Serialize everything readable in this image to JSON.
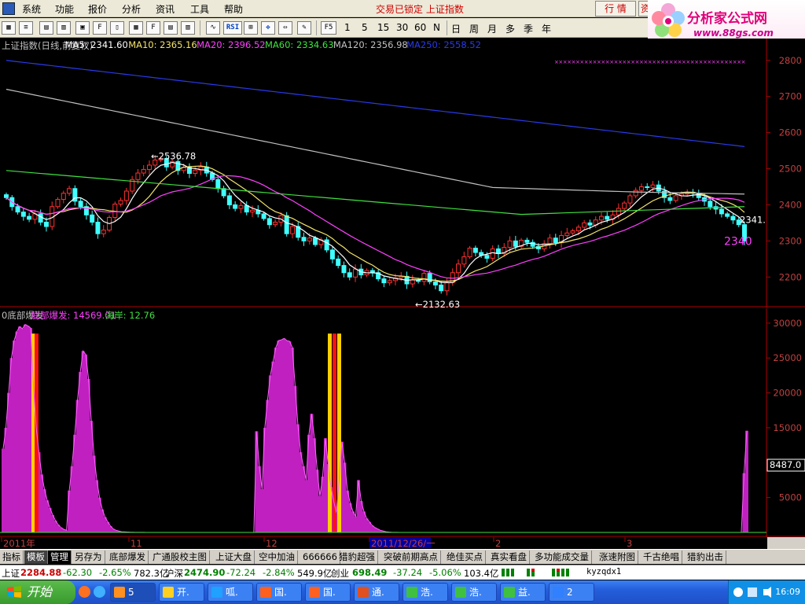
{
  "menu": {
    "items": [
      "系统",
      "功能",
      "报价",
      "分析",
      "资讯",
      "工具",
      "帮助"
    ],
    "title": "交易已锁定 上证指数",
    "quote_button": "行 情",
    "info_button": "资"
  },
  "toolbar": {
    "icons": [
      "F5",
      "RSI"
    ],
    "periods": [
      "1",
      "5",
      "15",
      "30",
      "60",
      "N",
      "日",
      "周",
      "月",
      "多",
      "季",
      "年"
    ]
  },
  "logo": {
    "name": "分析家公式网",
    "url": "www.88gs.com"
  },
  "price_chart": {
    "header": [
      {
        "text": "上证指数(日线,前复权)",
        "color": "#c0c0c0"
      },
      {
        "text": "MA5: 2341.60",
        "color": "#ffffff"
      },
      {
        "text": "MA10: 2365.16",
        "color": "#f4e46a"
      },
      {
        "text": "MA20: 2396.52",
        "color": "#ff40ff"
      },
      {
        "text": "MA60: 2334.63",
        "color": "#40e040"
      },
      {
        "text": "MA120: 2356.98",
        "color": "#c0c0c0"
      },
      {
        "text": "MA250: 2558.52",
        "color": "#2a3ae8"
      }
    ],
    "annotations": {
      "high": "2536.78",
      "low": "←2132.63",
      "last": "2341.",
      "current": "2340"
    }
  },
  "indicator": {
    "header": [
      {
        "text": "0底部爆发",
        "color": "#c0c0c0"
      },
      {
        "text": "底部爆发: 14569.01",
        "color": "#ff40ff"
      },
      {
        "text": "海岸: 12.76",
        "color": "#40e040"
      }
    ],
    "current_value": "8487.0"
  },
  "date_axis": {
    "labels": [
      "2011年",
      "11",
      "12",
      "2011/12/26/一",
      "2",
      "3"
    ],
    "period": "日线"
  },
  "tabs": [
    "指标",
    "模板",
    "管理",
    "另存为",
    "底部爆发",
    "广通股校主图",
    "上证大盘",
    "空中加油",
    "666666",
    "猎豹超强",
    "突破前期高点",
    "绝佳买点",
    "真实看盘",
    "多功能成交量",
    "涨速附图",
    "千古绝唱",
    "猎豹出击"
  ],
  "index_strip": [
    {
      "name": "上证",
      "value": "2284.88",
      "change": "-62.30",
      "pct": "-2.65%",
      "amount": "782.3亿"
    },
    {
      "name": "沪深",
      "value": "2474.90",
      "change": "-72.24",
      "pct": "-2.84%",
      "amount": "549.9亿"
    },
    {
      "name": "创业",
      "value": "698.49",
      "change": "-37.24",
      "pct": "-5.06%",
      "amount": "103.4亿"
    }
  ],
  "input_method": "kyzqdx1",
  "taskbar": {
    "start": "开始",
    "tasks": [
      "5",
      "开.",
      "呱.",
      "国.",
      "国.",
      "通.",
      "浩.",
      "浩.",
      "益.",
      "2"
    ],
    "clock": "16:09"
  },
  "chart_data": [
    {
      "type": "candlestick",
      "title": "上证指数(日线,前复权)",
      "ylim": [
        2120,
        2830
      ],
      "y_ticks": [
        2800,
        2700,
        2600,
        2500,
        2400,
        2300,
        2200
      ],
      "x_labels": [
        "2011年",
        "11",
        "12",
        "2011/12/26/一",
        "2",
        "3"
      ],
      "extremes": {
        "high": 2536.78,
        "low": 2132.63
      },
      "close": [
        2420,
        2395,
        2380,
        2368,
        2360,
        2375,
        2352,
        2340,
        2395,
        2415,
        2432,
        2445,
        2410,
        2395,
        2372,
        2352,
        2320,
        2330,
        2365,
        2402,
        2412,
        2438,
        2470,
        2488,
        2498,
        2510,
        2524,
        2528,
        2505,
        2520,
        2495,
        2504,
        2487,
        2496,
        2505,
        2488,
        2470,
        2445,
        2425,
        2400,
        2390,
        2398,
        2380,
        2385,
        2375,
        2362,
        2345,
        2352,
        2370,
        2320,
        2340,
        2310,
        2300,
        2308,
        2290,
        2303,
        2275,
        2250,
        2232,
        2212,
        2200,
        2222,
        2206,
        2218,
        2212,
        2195,
        2184,
        2190,
        2198,
        2202,
        2181,
        2192,
        2188,
        2210,
        2187,
        2178,
        2162,
        2185,
        2212,
        2236,
        2256,
        2280,
        2268,
        2260,
        2252,
        2278,
        2265,
        2282,
        2300,
        2285,
        2302,
        2296,
        2285,
        2278,
        2292,
        2308,
        2295,
        2315,
        2322,
        2328,
        2338,
        2350,
        2344,
        2358,
        2368,
        2360,
        2372,
        2390,
        2405,
        2425,
        2440,
        2450,
        2448,
        2455,
        2438,
        2420,
        2412,
        2425,
        2430,
        2435,
        2432,
        2420,
        2410,
        2395,
        2388,
        2375,
        2368,
        2358,
        2345,
        2300
      ],
      "series": [
        {
          "name": "MA5",
          "values": [
            2341.6
          ]
        },
        {
          "name": "MA10",
          "values": [
            2365.16
          ]
        },
        {
          "name": "MA20",
          "values": [
            2396.52
          ]
        },
        {
          "name": "MA60",
          "values": [
            2334.63
          ]
        },
        {
          "name": "MA120",
          "values": [
            2356.98
          ]
        },
        {
          "name": "MA250",
          "values": [
            2558.52
          ]
        }
      ]
    },
    {
      "type": "bar",
      "title": "0底部爆发",
      "ylim": [
        0,
        31000
      ],
      "y_ticks": [
        30000,
        25000,
        20000,
        15000,
        10000,
        5000
      ],
      "series": [
        {
          "name": "底部爆发",
          "values": [
            14569.01
          ]
        },
        {
          "name": "海岸",
          "values": [
            12.76
          ]
        }
      ],
      "values": [
        12000,
        15000,
        20000,
        25000,
        27500,
        28800,
        29500,
        29200,
        29800,
        29600,
        29300,
        21000,
        15000,
        11500,
        8300,
        6200,
        4600,
        3500,
        2500,
        1700,
        1100,
        700,
        450,
        300,
        6000,
        9500,
        14000,
        19000,
        23000,
        26000,
        25500,
        22000,
        16000,
        11000,
        7500,
        5000,
        3300,
        2200,
        1500,
        900,
        500,
        300,
        200,
        100,
        80,
        60,
        40,
        30,
        20,
        15,
        10,
        10,
        5,
        5,
        5,
        5,
        5,
        5,
        5,
        5,
        0,
        0,
        0,
        0,
        0,
        0,
        0,
        0,
        0,
        0,
        0,
        0,
        0,
        0,
        0,
        0,
        0,
        0,
        0,
        0,
        0,
        0,
        0,
        0,
        0,
        0,
        0,
        0,
        0,
        0,
        0,
        0,
        14500,
        9500,
        6200,
        15000,
        19000,
        22500,
        24500,
        26500,
        27500,
        27600,
        27800,
        27500,
        27400,
        26500,
        21000,
        15500,
        11500,
        9500,
        7500,
        14000,
        17000,
        13500,
        9000,
        5200,
        8000,
        13500,
        9800,
        6500,
        4500,
        2800,
        7500,
        13000,
        10000,
        6000,
        4200,
        3000,
        2300,
        7500,
        4500,
        3000,
        2000,
        1500,
        1000,
        700,
        500,
        300,
        200,
        100,
        50,
        30,
        20,
        10,
        5,
        5,
        0,
        0,
        0,
        0,
        0,
        0,
        0,
        0,
        0,
        0,
        0,
        0,
        0,
        0,
        0,
        0,
        0,
        0,
        0,
        0,
        0,
        0,
        0,
        0,
        0,
        0,
        0,
        0,
        0,
        0,
        0,
        0,
        0,
        0,
        0,
        0,
        0,
        0,
        0,
        0,
        0,
        0,
        0,
        0,
        0,
        0,
        0,
        0,
        0,
        0,
        0,
        0,
        0,
        0,
        0,
        0,
        0,
        0,
        0,
        0,
        0,
        0,
        0,
        0,
        0,
        0,
        0,
        0,
        0,
        0,
        0,
        0,
        0,
        0,
        0,
        0,
        0,
        0,
        0,
        0,
        0,
        0,
        0,
        0,
        0,
        0,
        0,
        0,
        0,
        0,
        0,
        0,
        0,
        0,
        0,
        0,
        0,
        0,
        0,
        0,
        0,
        0,
        0,
        0,
        0,
        0,
        0,
        0,
        0,
        0,
        0,
        0,
        0,
        0,
        0,
        0,
        0,
        0,
        0,
        0,
        0,
        0,
        0,
        8500,
        14569
      ]
    }
  ]
}
